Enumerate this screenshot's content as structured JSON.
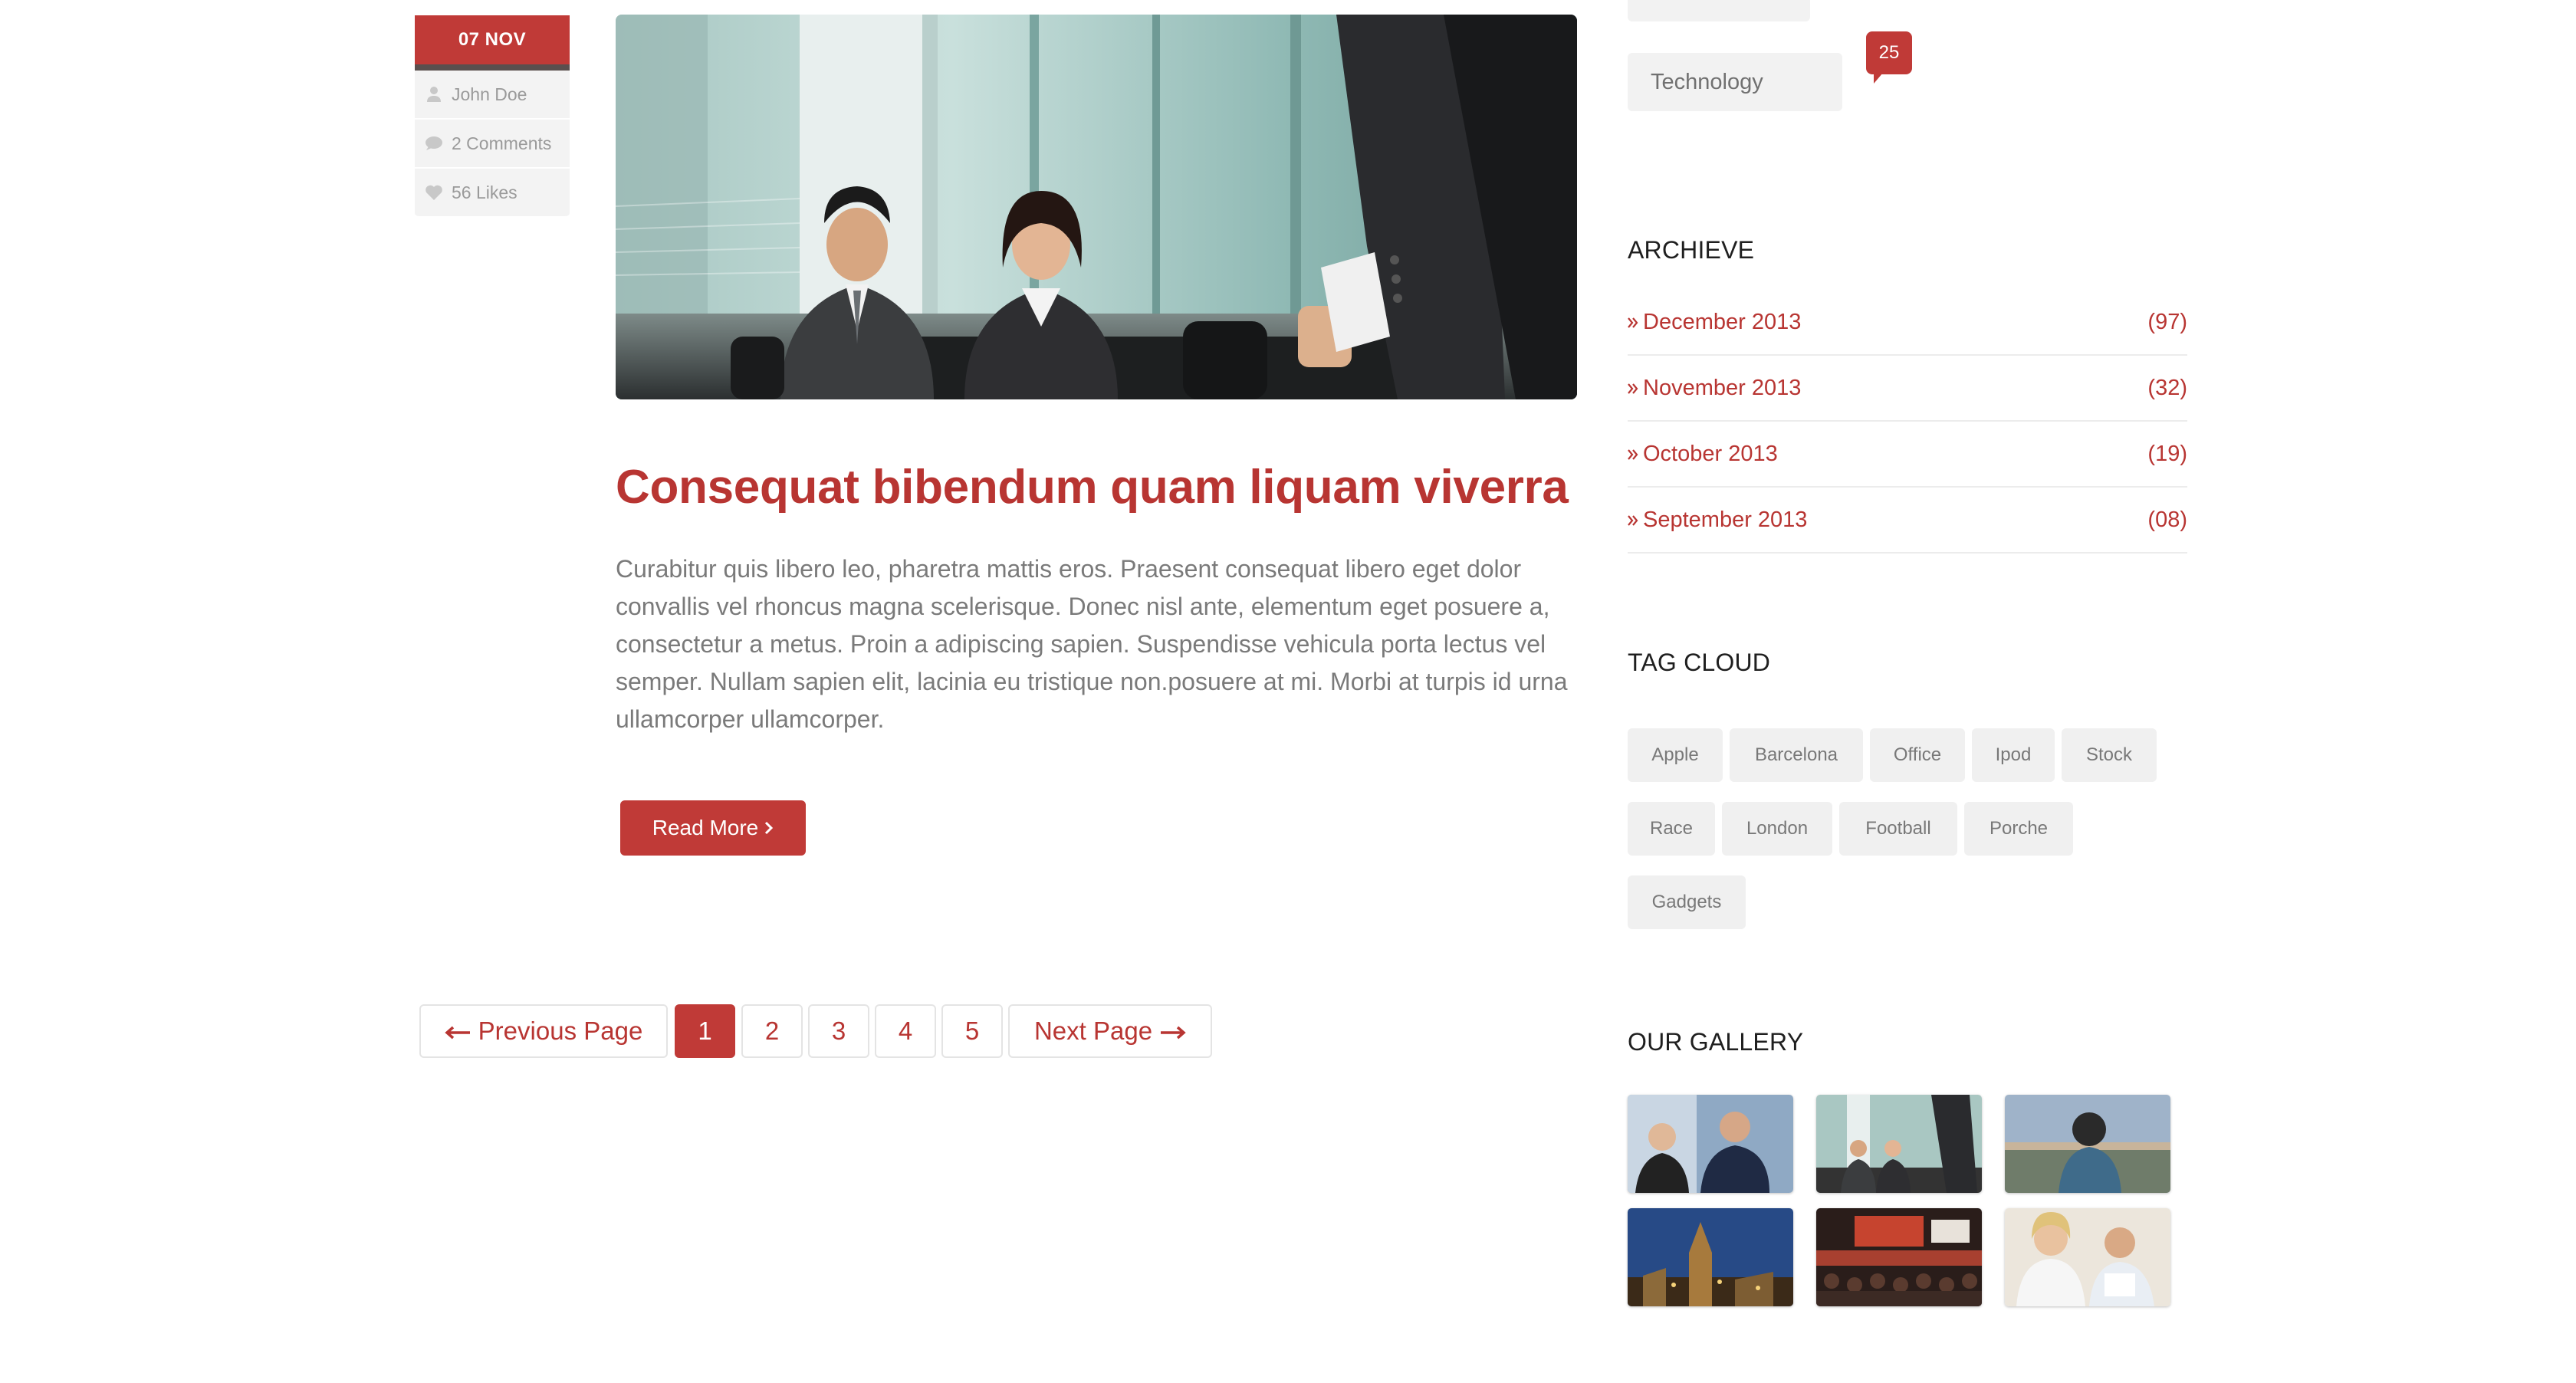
{
  "post": {
    "date": "07 NOV",
    "author": "John Doe",
    "comments": "2 Comments",
    "likes": "56 Likes",
    "title": "Consequat bibendum quam liquam viverra",
    "excerpt": "Curabitur quis libero leo, pharetra mattis eros. Praesent consequat libero eget dolor convallis vel rhoncus magna scelerisque. Donec nisl ante, elementum eget posuere a, consectetur a metus. Proin a adipiscing sapien. Suspendisse vehicula porta lectus vel semper. Nullam sapien elit, lacinia eu tristique non.posuere at mi. Morbi at turpis id urna ullamcorper ullamcorper.",
    "read_more": "Read More",
    "icons": {
      "author": "user-icon",
      "comments": "comment-icon",
      "likes": "heart-icon",
      "read_more": "chevron-right-icon"
    }
  },
  "pagination": {
    "previous": "Previous Page",
    "next": "Next Page",
    "pages": [
      "1",
      "2",
      "3",
      "4",
      "5"
    ],
    "current": "1"
  },
  "sidebar": {
    "category": {
      "label": "Technology",
      "count": "25"
    },
    "archive": {
      "heading": "ARCHIEVE",
      "items": [
        {
          "label": "December 2013",
          "count": "(97)"
        },
        {
          "label": "November 2013",
          "count": "(32)"
        },
        {
          "label": "October 2013",
          "count": "(19)"
        },
        {
          "label": "September 2013",
          "count": "(08)"
        }
      ]
    },
    "tag_cloud": {
      "heading": "TAG CLOUD",
      "tags": [
        "Apple",
        "Barcelona",
        "Office",
        "Ipod",
        "Stock",
        "Race",
        "London",
        "Football",
        "Porche",
        "Gadgets"
      ]
    },
    "gallery": {
      "heading": "OUR GALLERY"
    }
  },
  "colors": {
    "accent": "#c03a37",
    "title": "#b83532",
    "text": "#7a7a7a",
    "pill_bg": "#f0f0f0"
  }
}
